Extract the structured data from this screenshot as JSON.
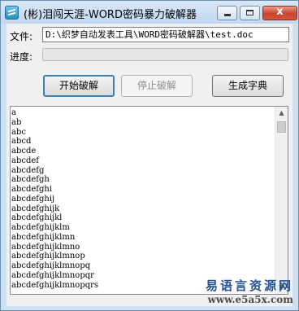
{
  "window": {
    "title": "(彬)泪闯天涯-WORD密码暴力破解器",
    "close_label": "x"
  },
  "file": {
    "label": "文件:",
    "path": "D:\\织梦自动发表工具\\WORD密码破解器\\test.doc"
  },
  "progress": {
    "label": "进度:",
    "value": 0
  },
  "buttons": {
    "start": "开始破解",
    "stop": "停止破解",
    "dict": "生成字典"
  },
  "list": {
    "items": [
      "a",
      "ab",
      "abc",
      "abcd",
      "abcde",
      "abcdef",
      "abcdefg",
      "abcdefgh",
      "abcdefghi",
      "abcdefghij",
      "abcdefghijk",
      "abcdefghijkl",
      "abcdefghijklm",
      "abcdefghijklmn",
      "abcdefghijklmno",
      "abcdefghijklmnop",
      "abcdefghijklmnopq",
      "abcdefghijklmnopqr",
      "abcdefghijklmnopqrs"
    ]
  },
  "watermark": {
    "cn": "易语言资源网",
    "url": "www.e5a5x.com"
  },
  "colors": {
    "progress_fill": "#06b025"
  }
}
